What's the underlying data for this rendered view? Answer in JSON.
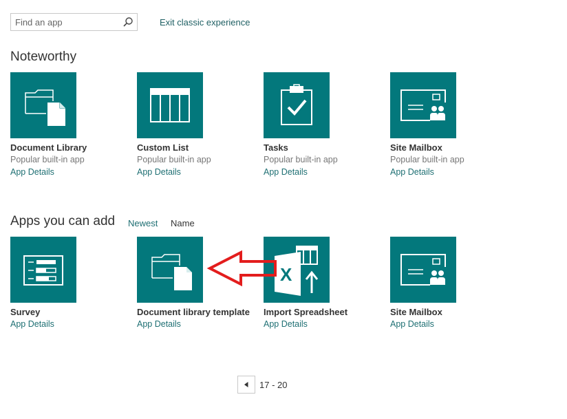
{
  "search": {
    "placeholder": "Find an app"
  },
  "header": {
    "exit_link": "Exit classic experience"
  },
  "noteworthy": {
    "title": "Noteworthy",
    "apps": [
      {
        "name": "Document Library",
        "description": "Popular built-in app",
        "details_label": "App Details",
        "icon": "document-library-icon"
      },
      {
        "name": "Custom List",
        "description": "Popular built-in app",
        "details_label": "App Details",
        "icon": "custom-list-icon"
      },
      {
        "name": "Tasks",
        "description": "Popular built-in app",
        "details_label": "App Details",
        "icon": "tasks-icon"
      },
      {
        "name": "Site Mailbox",
        "description": "Popular built-in app",
        "details_label": "App Details",
        "icon": "site-mailbox-icon"
      }
    ]
  },
  "apps_you_can_add": {
    "title": "Apps you can add",
    "sort_newest": "Newest",
    "sort_name": "Name",
    "apps": [
      {
        "name": "Survey",
        "details_label": "App Details",
        "icon": "survey-icon"
      },
      {
        "name": "Document library template",
        "details_label": "App Details",
        "icon": "document-library-icon"
      },
      {
        "name": "Import Spreadsheet",
        "details_label": "App Details",
        "icon": "excel-import-icon"
      },
      {
        "name": "Site Mailbox",
        "details_label": "App Details",
        "icon": "site-mailbox-icon"
      }
    ]
  },
  "pager": {
    "range": "17 - 20",
    "prev_icon": "chevron-left-icon"
  },
  "colors": {
    "tile": "#03787c",
    "link": "#1e6f73",
    "arrow": "#e31d1d"
  }
}
